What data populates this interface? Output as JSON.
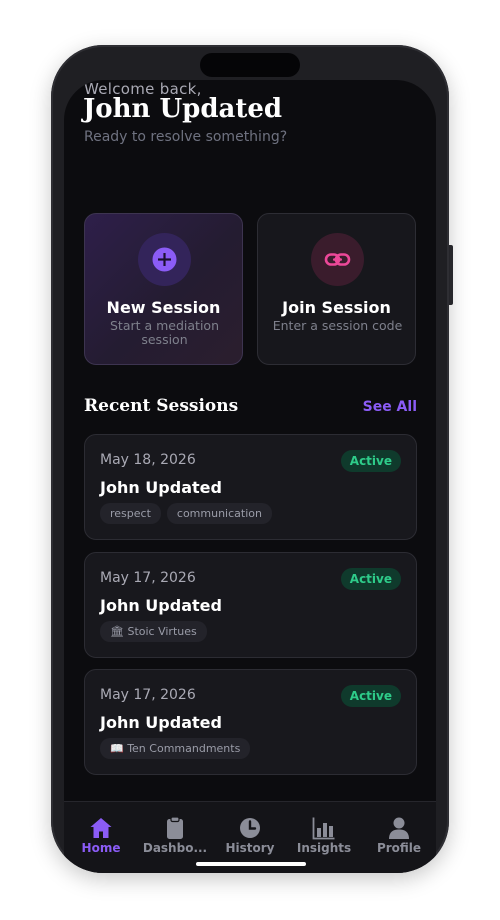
{
  "header": {
    "welcome": "Welcome back,",
    "username": "John Updated",
    "tagline": "Ready to resolve something?"
  },
  "actions": {
    "new_session": {
      "title": "New Session",
      "subtitle": "Start a mediation session",
      "icon": "plus-icon"
    },
    "join_session": {
      "title": "Join Session",
      "subtitle": "Enter a session code",
      "icon": "link-icon"
    }
  },
  "recent": {
    "title": "Recent Sessions",
    "see_all": "See All",
    "sessions": [
      {
        "date": "May 18, 2026",
        "status": "Active",
        "name": "John Updated",
        "tags": [
          "respect",
          "communication"
        ]
      },
      {
        "date": "May 17, 2026",
        "status": "Active",
        "name": "John Updated",
        "tags": [
          "🏛 Stoic Virtues"
        ]
      },
      {
        "date": "May 17, 2026",
        "status": "Active",
        "name": "John Updated",
        "tags": [
          "📖 Ten Commandments"
        ]
      }
    ]
  },
  "tabs": [
    {
      "label": "Home",
      "icon": "home-icon",
      "active": true
    },
    {
      "label": "Dashbo...",
      "icon": "clipboard-icon",
      "active": false
    },
    {
      "label": "History",
      "icon": "clock-icon",
      "active": false
    },
    {
      "label": "Insights",
      "icon": "bar-chart-icon",
      "active": false
    },
    {
      "label": "Profile",
      "icon": "person-icon",
      "active": false
    }
  ],
  "colors": {
    "accent": "#8b5cf6",
    "active_badge": "#2ecc8a",
    "join_icon": "#ec4899",
    "background": "#0c0c0f"
  }
}
